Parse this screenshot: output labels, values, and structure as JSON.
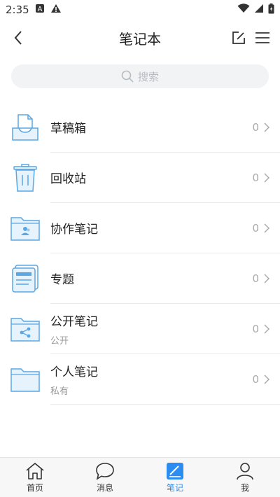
{
  "status_bar": {
    "time": "2:35"
  },
  "header": {
    "title": "笔记本"
  },
  "search": {
    "placeholder": "搜索"
  },
  "items": [
    {
      "name": "草稿箱",
      "sub": "",
      "count": "0"
    },
    {
      "name": "回收站",
      "sub": "",
      "count": "0"
    },
    {
      "name": "协作笔记",
      "sub": "",
      "count": "0"
    },
    {
      "name": "专题",
      "sub": "",
      "count": "0"
    },
    {
      "name": "公开笔记",
      "sub": "公开",
      "count": "0"
    },
    {
      "name": "个人笔记",
      "sub": "私有",
      "count": "0"
    }
  ],
  "tabs": [
    {
      "label": "首页",
      "icon": "home-icon"
    },
    {
      "label": "消息",
      "icon": "chat-icon"
    },
    {
      "label": "笔记",
      "icon": "note-icon",
      "active": true
    },
    {
      "label": "我",
      "icon": "user-icon"
    }
  ],
  "colors": {
    "accent": "#2d8cf0",
    "icon_blue": "#5aa7e6",
    "icon_fill": "#e6f2fc"
  }
}
